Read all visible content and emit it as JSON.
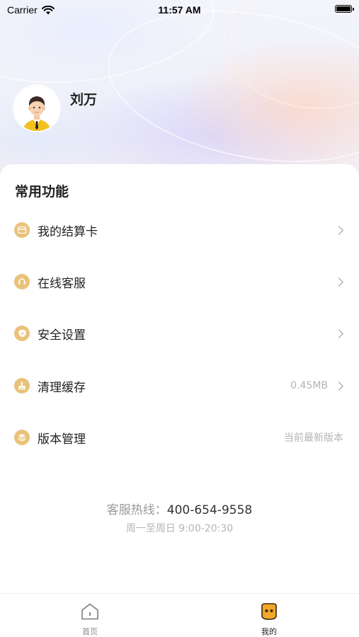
{
  "status_bar": {
    "carrier": "Carrier",
    "time": "11:57 AM"
  },
  "profile": {
    "username": "刘万"
  },
  "section_title": "常用功能",
  "menu": [
    {
      "label": "我的结算卡",
      "value": "",
      "icon": "card-icon",
      "has_chevron": true
    },
    {
      "label": "在线客服",
      "value": "",
      "icon": "headset-icon",
      "has_chevron": true
    },
    {
      "label": "安全设置",
      "value": "",
      "icon": "shield-icon",
      "has_chevron": true
    },
    {
      "label": "清理缓存",
      "value": "0.45MB",
      "icon": "broom-icon",
      "has_chevron": true
    },
    {
      "label": "版本管理",
      "value": "当前最新版本",
      "icon": "layers-icon",
      "has_chevron": false
    }
  ],
  "support": {
    "hotline_label": "客服热线：",
    "hotline_number": "400-654-9558",
    "hours": "周一至周日 9:00-20:30"
  },
  "tabbar": {
    "home_label": "首页",
    "mine_label": "我的"
  },
  "colors": {
    "accent": "#e9c27a",
    "active_tab": "#f2a62b",
    "text_primary": "#222222",
    "text_muted": "#b4b4b4"
  }
}
